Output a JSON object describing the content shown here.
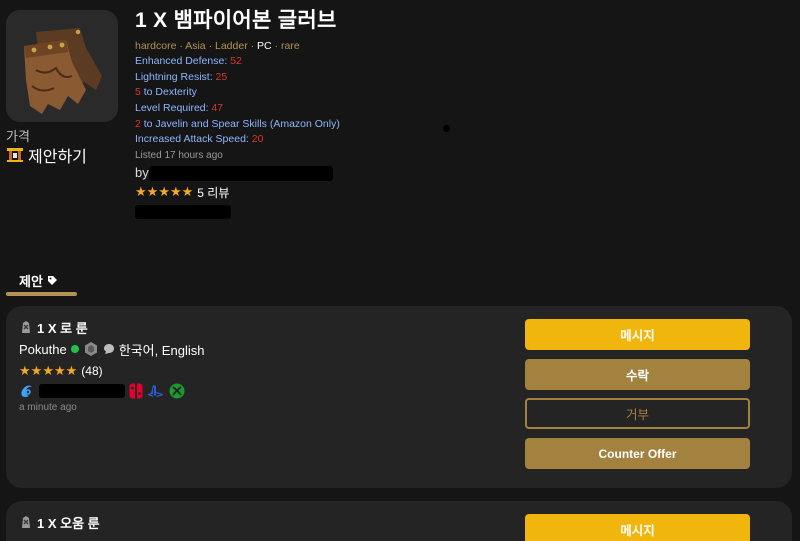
{
  "item": {
    "quantity_prefix": "1 X",
    "name": "뱀파이어본 글러브",
    "meta": [
      "hardcore",
      "Asia",
      "Ladder",
      "PC",
      "rare"
    ],
    "meta_highlight": "PC",
    "stats": [
      {
        "label": "Enhanced Defense: ",
        "value": "52",
        "value_first": false
      },
      {
        "label": "Lightning Resist: ",
        "value": "25",
        "value_first": false
      },
      {
        "label": " to Dexterity",
        "value": "5",
        "value_first": true
      },
      {
        "label": "Level Required: ",
        "value": "47",
        "value_first": false
      },
      {
        "label": " to Javelin and Spear Skills (Amazon Only)",
        "value": "2",
        "value_first": true
      },
      {
        "label": "Increased Attack Speed: ",
        "value": "20",
        "value_first": false
      }
    ],
    "listed": "Listed 17 hours ago",
    "by_label": "by",
    "seller_rating": 5,
    "seller_reviews": "5 리뷰"
  },
  "price": {
    "label": "가격",
    "offer_label": "제안하기"
  },
  "tabs": [
    {
      "label": "제안",
      "icon": "tag-icon",
      "active": true
    }
  ],
  "offers": [
    {
      "title": "1 X 로 룬",
      "rune_icon": "rune-icon",
      "user": "Pokuthe",
      "online": true,
      "languages": "한국어, English",
      "rating": 5,
      "rating_count": "(48)",
      "platforms": [
        "battlenet-icon",
        "nintendo-switch-icon",
        "playstation-icon",
        "xbox-icon"
      ],
      "time_ago": "a minute ago",
      "buttons": {
        "message": "메시지",
        "accept": "수락",
        "reject": "거부",
        "counter": "Counter Offer"
      }
    },
    {
      "title": "1 X 오움 룬",
      "rune_icon": "rune-icon",
      "buttons": {
        "message": "메시지"
      }
    }
  ],
  "colors": {
    "gold": "#f0b60e",
    "bronze": "#a3823f",
    "stat_blue": "#8fb6ff",
    "stat_red": "#d9352a",
    "star": "#f6a823",
    "online": "#25c04a"
  }
}
